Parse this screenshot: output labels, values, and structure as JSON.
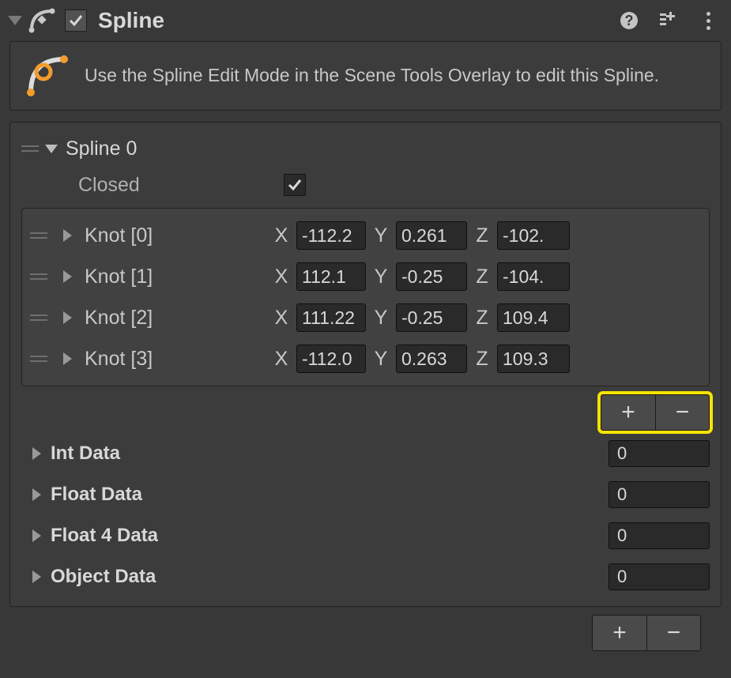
{
  "component": {
    "title": "Spline",
    "enabled": true
  },
  "info": {
    "text": "Use the Spline Edit Mode in the Scene Tools Overlay to edit this Spline."
  },
  "spline": {
    "name": "Spline 0",
    "closed_label": "Closed",
    "closed": true,
    "knots": [
      {
        "label": "Knot [0]",
        "x": "-112.2",
        "y": "0.261",
        "z": "-102."
      },
      {
        "label": "Knot [1]",
        "x": "112.1",
        "y": "-0.25",
        "z": "-104."
      },
      {
        "label": "Knot [2]",
        "x": "111.22",
        "y": "-0.25",
        "z": "109.4"
      },
      {
        "label": "Knot [3]",
        "x": "-112.0",
        "y": "0.263",
        "z": "109.3"
      }
    ]
  },
  "axis_labels": {
    "x": "X",
    "y": "Y",
    "z": "Z"
  },
  "data_sections": {
    "int": {
      "label": "Int Data",
      "count": "0"
    },
    "float": {
      "label": "Float Data",
      "count": "0"
    },
    "float4": {
      "label": "Float 4 Data",
      "count": "0"
    },
    "object": {
      "label": "Object Data",
      "count": "0"
    }
  },
  "glyphs": {
    "plus": "+",
    "minus": "−"
  },
  "icons": {
    "component": "spline-component-icon",
    "help": "help-icon",
    "presets": "presets-icon",
    "menu": "kebab-menu-icon",
    "info": "spline-edit-info-icon"
  }
}
